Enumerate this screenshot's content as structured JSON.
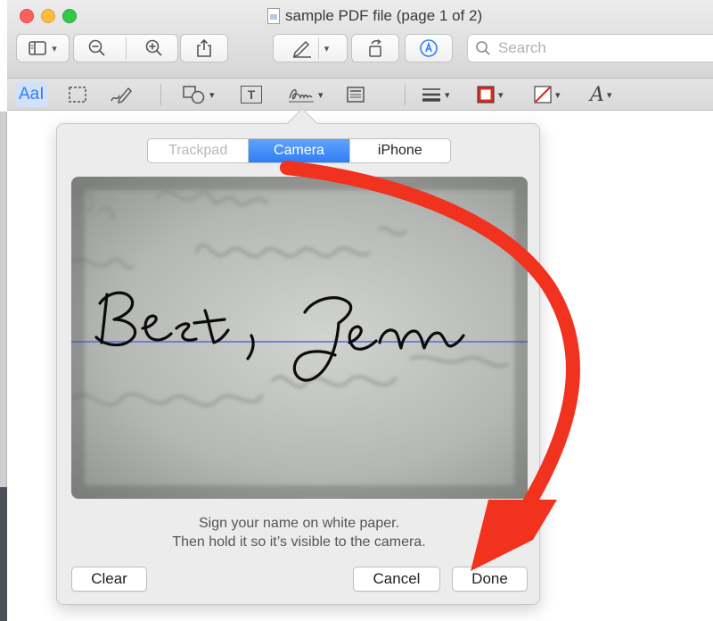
{
  "window": {
    "title": "sample PDF file (page 1 of 2)"
  },
  "toolbar": {
    "search_placeholder": "Search",
    "zoom_out_glyph": "−",
    "zoom_in_glyph": "+"
  },
  "markup_toolbar": {
    "text_style_label": "AaI",
    "text_box_glyph": "T",
    "font_glyph": "A"
  },
  "signature_popover": {
    "tabs": [
      {
        "label": "Trackpad",
        "state": "disabled"
      },
      {
        "label": "Camera",
        "state": "selected"
      },
      {
        "label": "iPhone",
        "state": "normal"
      }
    ],
    "instructions_line1": "Sign your name on white paper.",
    "instructions_line2": "Then hold it so it’s visible to the camera.",
    "buttons": {
      "clear": "Clear",
      "cancel": "Cancel",
      "done": "Done"
    }
  },
  "colors": {
    "accent": "#2f7ef6",
    "annotation_arrow": "#f0321e",
    "baseline": "#4a6fd9"
  },
  "icons": [
    "sidebar-icon",
    "zoom-out-icon",
    "zoom-in-icon",
    "share-icon",
    "pen-markup-icon",
    "rotate-icon",
    "annotate-icon",
    "search-icon",
    "select-rect-icon",
    "sketch-icon",
    "shapes-icon",
    "signature-icon",
    "note-icon",
    "line-style-icon",
    "border-color-icon",
    "fill-color-icon"
  ]
}
